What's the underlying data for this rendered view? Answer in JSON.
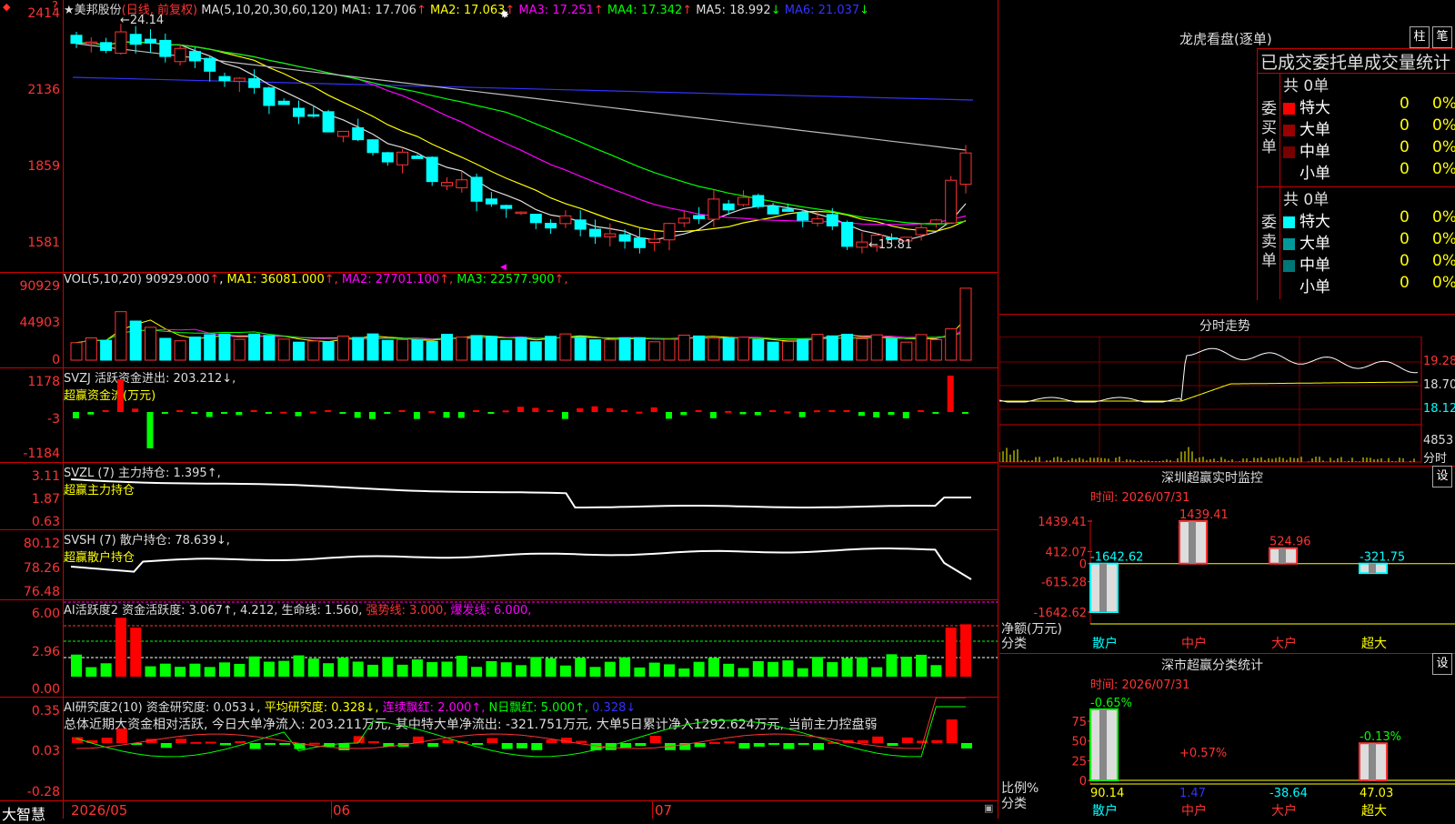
{
  "chart_main": {
    "stock_name": "美邦股份",
    "period": "(日线, 前复权)",
    "ma_label": "MA(5,10,20,30,60,120)",
    "ma": [
      {
        "label": "MA1:",
        "value": "17.706",
        "arrow": "↑",
        "color": "#dddddd"
      },
      {
        "label": "MA2:",
        "value": "17.063",
        "arrow": "↑",
        "color": "#ffff00"
      },
      {
        "label": "MA3:",
        "value": "17.251",
        "arrow": "↑",
        "color": "#ff00ff"
      },
      {
        "label": "MA4:",
        "value": "17.342",
        "arrow": "↑",
        "color": "#00ff00"
      },
      {
        "label": "MA5:",
        "value": "18.992",
        "arrow": "↓",
        "color": "#dddddd"
      },
      {
        "label": "MA6:",
        "value": "21.037",
        "arrow": "↓",
        "color": "#3333ff"
      }
    ],
    "y_ticks": [
      "2414",
      "2136",
      "1859",
      "1581"
    ],
    "high_label": "24.14",
    "low_label": "15.81"
  },
  "vol": {
    "title": "VOL(5,10,20)",
    "value": "90929.000",
    "ma": [
      {
        "label": "MA1:",
        "value": "36081.000",
        "arrow": "↑",
        "color": "#ffff00"
      },
      {
        "label": "MA2:",
        "value": "27701.100",
        "arrow": "↑",
        "color": "#ff00ff"
      },
      {
        "label": "MA3:",
        "value": "22577.900",
        "arrow": "↑",
        "color": "#00ff00"
      }
    ],
    "y_ticks": [
      "90929",
      "44903",
      "0"
    ]
  },
  "svzj": {
    "title": "SVZJ  活跃资金进出: 203.212↓,",
    "subtitle": "超赢资金流(万元)",
    "y_ticks": [
      "1178",
      "-3",
      "-1184"
    ]
  },
  "svzl": {
    "title": "SVZL (7) 主力持仓: 1.395↑,",
    "subtitle": "超赢主力持仓",
    "y_ticks": [
      "3.11",
      "1.87",
      "0.63"
    ]
  },
  "svsh": {
    "title": "SVSH (7) 散户持仓: 78.639↓,",
    "subtitle": "超赢散户持仓",
    "y_ticks": [
      "80.12",
      "78.26",
      "76.48"
    ]
  },
  "ai_activity": {
    "title": "AI活跃度2 资金活跃度: 3.067↑, 4.212, 生命线: 1.560,",
    "strong": "强势线: 3.000,",
    "burst": "爆发线: 6.000,",
    "y_ticks": [
      "6.00",
      "2.96",
      "0.00"
    ]
  },
  "ai_research": {
    "title": "AI研究度2(10) 资金研究度: 0.053↓,",
    "avg": "平均研究度: 0.328↓,",
    "streak": "连续飘红: 2.000↑,",
    "nday": "N日飘红: 5.000↑,",
    "extra": "0.328↓",
    "summary": "总体近期大资金相对活跃, 今日大单净流入: 203.211万元, 其中特大单净流出: -321.751万元, 大单5日累计净入1292.624万元, 当前主力控盘弱",
    "y_ticks": [
      "0.35",
      "0.03",
      "-0.28"
    ]
  },
  "x_axis": {
    "labels": [
      "2026/05",
      "06",
      "07"
    ],
    "brand": "大智慧"
  },
  "dragon_tiger": {
    "title": "龙虎看盘(逐单)",
    "btn_bar": "柱",
    "btn_pen": "笔",
    "subtitle": "已成交委托单成交量统计",
    "buy_label": "委买单",
    "sell_label": "委卖单",
    "buy_total": "共 0单",
    "sell_total": "共 0单",
    "buy_rows": [
      {
        "name": "特大",
        "count": "0",
        "pct": "0%",
        "color": "#ff0000"
      },
      {
        "name": "大单",
        "count": "0",
        "pct": "0%",
        "color": "#990000"
      },
      {
        "name": "中单",
        "count": "0",
        "pct": "0%",
        "color": "#770000"
      },
      {
        "name": "小单",
        "count": "0",
        "pct": "0%",
        "color": ""
      }
    ],
    "sell_rows": [
      {
        "name": "特大",
        "count": "0",
        "pct": "0%",
        "color": "#00ffff"
      },
      {
        "name": "大单",
        "count": "0",
        "pct": "0%",
        "color": "#009999"
      },
      {
        "name": "中单",
        "count": "0",
        "pct": "0%",
        "color": "#007777"
      },
      {
        "name": "小单",
        "count": "0",
        "pct": "0%",
        "color": ""
      }
    ]
  },
  "intraday": {
    "title": "分时走势",
    "y_ticks": [
      "19.28",
      "18.70",
      "18.12"
    ],
    "vol_tick": "4853",
    "vol_label": "分时"
  },
  "sz_monitor": {
    "title": "深圳超赢实时监控",
    "btn": "设",
    "time": "时间: 2026/07/31",
    "y_ticks": [
      "1439.41",
      "412.07",
      "0",
      "-615.28",
      "-1642.62"
    ],
    "unit": "净额(万元)",
    "cat_label": "分类",
    "categories": [
      "散户",
      "中户",
      "大户",
      "超大"
    ],
    "values": [
      -1642.62,
      1439.41,
      524.96,
      -321.75
    ],
    "value_labels": [
      "-1642.62",
      "1439.41",
      "524.96",
      "-321.75"
    ]
  },
  "sz_class": {
    "title": "深市超赢分类统计",
    "btn": "设",
    "time": "时间: 2026/07/31",
    "y_ticks": [
      "75",
      "50",
      "25",
      "0"
    ],
    "unit": "比例%",
    "cat_label": "分类",
    "categories": [
      "散户",
      "中户",
      "大户",
      "超大"
    ],
    "top_labels": [
      "-0.65%",
      "+0.57%",
      "",
      "-0.13%"
    ],
    "bottom_labels": [
      "90.14",
      "1.47",
      "-38.64",
      "47.03"
    ],
    "values": [
      90.14,
      1.47,
      0,
      47.03
    ]
  },
  "chart_data": [
    {
      "type": "bar",
      "title": "深圳超赢实时监控",
      "ylabel": "净额(万元)",
      "categories": [
        "散户",
        "中户",
        "大户",
        "超大"
      ],
      "values": [
        -1642.62,
        1439.41,
        524.96,
        -321.75
      ],
      "ylim": [
        -1642.62,
        1439.41
      ]
    },
    {
      "type": "bar",
      "title": "深市超赢分类统计",
      "ylabel": "比例%",
      "categories": [
        "散户",
        "中户",
        "大户",
        "超大"
      ],
      "values": [
        90.14,
        1.47,
        0,
        47.03
      ],
      "ylim": [
        0,
        90
      ]
    }
  ]
}
